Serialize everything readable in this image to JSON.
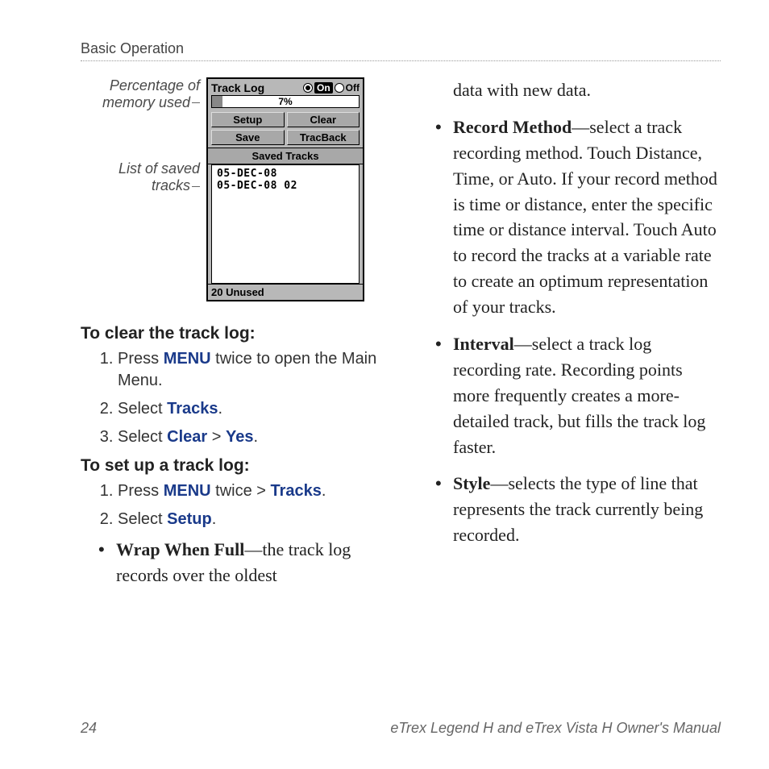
{
  "header": "Basic Operation",
  "callout1": "Percentage of memory used",
  "callout2": "List of saved tracks",
  "device": {
    "title": "Track Log",
    "on": "On",
    "off": "Off",
    "percent": "7%",
    "buttons": {
      "setup": "Setup",
      "clear": "Clear",
      "save": "Save",
      "tracback": "TracBack"
    },
    "section": "Saved Tracks",
    "items": [
      "05-DEC-08",
      "05-DEC-08 02"
    ],
    "status": "20 Unused"
  },
  "sec1_head": "To clear the track log:",
  "sec1": {
    "s1a": "Press ",
    "s1b": "MENU",
    "s1c": " twice to open the Main Menu.",
    "s2a": "Select ",
    "s2b": "Tracks",
    "s2c": ".",
    "s3a": "Select ",
    "s3b": "Clear",
    "s3c": " > ",
    "s3d": "Yes",
    "s3e": "."
  },
  "sec2_head": "To set up a track log:",
  "sec2": {
    "s1a": "Press ",
    "s1b": "MENU",
    "s1c": " twice > ",
    "s1d": "Tracks",
    "s1e": ".",
    "s2a": "Select ",
    "s2b": "Setup",
    "s2c": "."
  },
  "opt_wrap_term": "Wrap When Full",
  "opt_wrap_rest": "—the track log records over the oldest",
  "right_lead": "data with new data.",
  "opt_record_term": "Record Method",
  "opt_record_rest": "—select a track recording method. Touch Distance, Time, or Auto. If your record method is time or distance, enter the specific time or distance interval. Touch Auto to record the tracks at a variable rate to create an optimum representation of your tracks.",
  "opt_interval_term": "Interval",
  "opt_interval_rest": "—select a track log recording rate. Recording points more frequently creates a more-detailed track, but fills the track log faster.",
  "opt_style_term": "Style",
  "opt_style_rest": "—selects the type of line that represents the track currently being recorded.",
  "page_num": "24",
  "footer": "eTrex Legend H and eTrex Vista H Owner's Manual"
}
